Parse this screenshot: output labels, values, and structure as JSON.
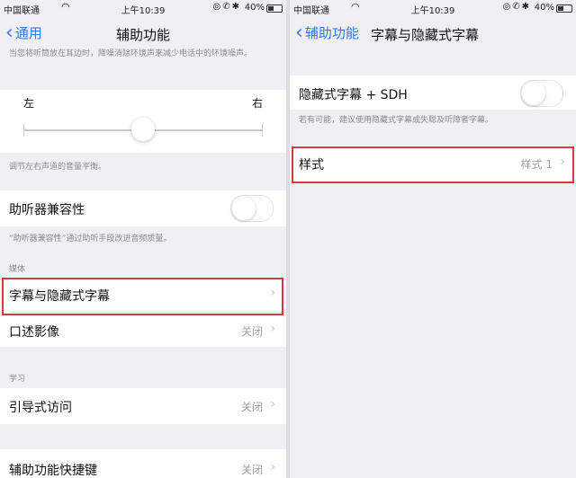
{
  "left": {
    "status": {
      "carrier": "中国联通",
      "time": "上午10:39",
      "battery": "40%"
    },
    "nav": {
      "back_label": "通用",
      "title": "辅助功能"
    },
    "top_note": "当您将听筒放在耳边时，降噪消除环境声来减少电话中的环境噪声。",
    "balance": {
      "left_label": "左",
      "right_label": "右",
      "level": 0.5,
      "footer": "调节左右声道的音量平衡。"
    },
    "hearing_aid": {
      "label": "助听器兼容性",
      "on": false,
      "footer": "“助听器兼容性”通过助听手段改进音频质量。"
    },
    "media": {
      "header": "媒体",
      "items": [
        {
          "label": "字幕与隐藏式字幕",
          "value": ""
        },
        {
          "label": "口述影像",
          "value": "关闭"
        }
      ]
    },
    "learning": {
      "header": "学习",
      "items": [
        {
          "label": "引导式访问",
          "value": "关闭"
        }
      ]
    },
    "shortcut": {
      "label": "辅助功能快捷键",
      "value": "关闭"
    }
  },
  "right": {
    "status": {
      "carrier": "中国联通",
      "time": "上午10:39",
      "battery": "40%"
    },
    "nav": {
      "back_label": "辅助功能",
      "title": "字幕与隐藏式字幕"
    },
    "sdh": {
      "label": "隐藏式字幕 + SDH",
      "on": false,
      "footer": "若有可能，建议使用隐藏式字幕或失聪及听障者字幕。"
    },
    "style": {
      "label": "样式",
      "value": "样式 1"
    }
  },
  "colors": {
    "accent": "#3478f6",
    "highlight": "#d8383f",
    "background": "#efeff4"
  }
}
